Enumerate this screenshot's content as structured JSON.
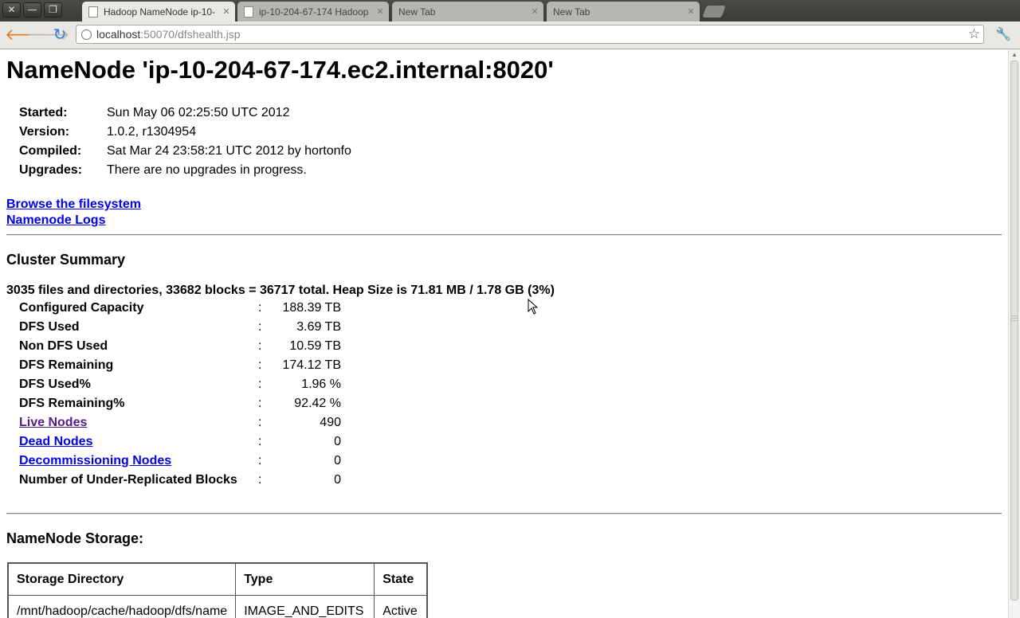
{
  "window": {
    "close_glyph": "✕",
    "minimize_glyph": "—",
    "maximize_glyph": "❐"
  },
  "tabs": [
    {
      "title": "Hadoop NameNode ip-10-",
      "active": true
    },
    {
      "title": "ip-10-204-67-174 Hadoop",
      "active": false
    },
    {
      "title": "New Tab",
      "active": false
    },
    {
      "title": "New Tab",
      "active": false
    }
  ],
  "toolbar": {
    "back_glyph": "🡐",
    "forward_glyph": "🡒",
    "reload_glyph": "↻",
    "url_host": "localhost",
    "url_rest": ":50070/dfshealth.jsp",
    "star_glyph": "☆",
    "wrench_glyph": "🔧"
  },
  "page": {
    "title": "NameNode 'ip-10-204-67-174.ec2.internal:8020'",
    "info": [
      {
        "label": "Started:",
        "value": "Sun May 06 02:25:50 UTC 2012"
      },
      {
        "label": "Version:",
        "value": "1.0.2, r1304954"
      },
      {
        "label": "Compiled:",
        "value": "Sat Mar 24 23:58:21 UTC 2012 by hortonfo"
      },
      {
        "label": "Upgrades:",
        "value": "There are no upgrades in progress."
      }
    ],
    "links": {
      "browse": "Browse the filesystem",
      "logs": "Namenode Logs"
    },
    "cluster_summary": {
      "heading": "Cluster Summary",
      "summary_line": "3035 files and directories, 33682 blocks = 36717 total. Heap Size is 71.81 MB / 1.78 GB (3%)",
      "rows": [
        {
          "label": "Configured Capacity",
          "sep": ":",
          "value": "188.39 TB"
        },
        {
          "label": "DFS Used",
          "sep": ":",
          "value": "3.69 TB"
        },
        {
          "label": "Non DFS Used",
          "sep": ":",
          "value": "10.59 TB"
        },
        {
          "label": "DFS Remaining",
          "sep": ":",
          "value": "174.12 TB"
        },
        {
          "label": "DFS Used%",
          "sep": ":",
          "value": "1.96 %"
        },
        {
          "label": "DFS Remaining%",
          "sep": ":",
          "value": "92.42 %"
        },
        {
          "label": "Live Nodes",
          "sep": ":",
          "value": "490"
        },
        {
          "label": "Dead Nodes",
          "sep": ":",
          "value": "0"
        },
        {
          "label": "Decommissioning Nodes",
          "sep": ":",
          "value": "0"
        },
        {
          "label": "Number of Under-Replicated Blocks",
          "sep": ":",
          "value": "0"
        }
      ]
    },
    "storage": {
      "heading": "NameNode Storage:",
      "headers": [
        "Storage Directory",
        "Type",
        "State"
      ],
      "rows": [
        [
          "/mnt/hadoop/cache/hadoop/dfs/name",
          "IMAGE_AND_EDITS",
          "Active"
        ]
      ]
    }
  },
  "colors": {
    "link": "#0000ee",
    "visited_link": "#551a8b",
    "nav_arrow": "#e07a1f",
    "reload": "#3a7bd5"
  }
}
